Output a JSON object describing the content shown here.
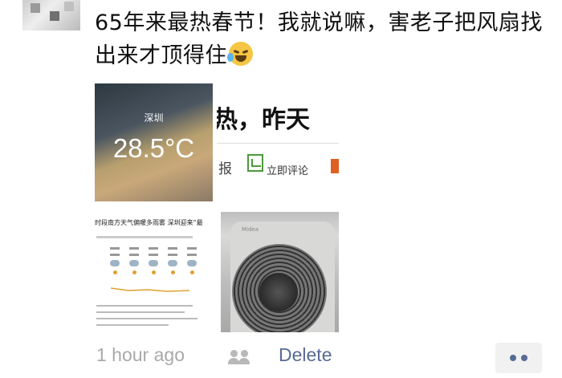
{
  "post": {
    "text": "65年来最热春节！我就说嘛，害老子把风扇找出来才顶得住",
    "emoji": "laughing-crying-emoji"
  },
  "images": {
    "weather": {
      "city": "深圳",
      "temperature": "28.5°C"
    },
    "news": {
      "headline": "热，昨天",
      "source_fragment": "报",
      "comment_label": "立即评论"
    },
    "article": {
      "headline": "时段南方天气偏暖多雨雾 深圳迎来“最"
    },
    "fan": {
      "brand": "Midea"
    }
  },
  "footer": {
    "time": "1 hour ago",
    "delete_label": "Delete",
    "colors": {
      "link": "#576b95",
      "muted": "#a9a9a9"
    }
  }
}
